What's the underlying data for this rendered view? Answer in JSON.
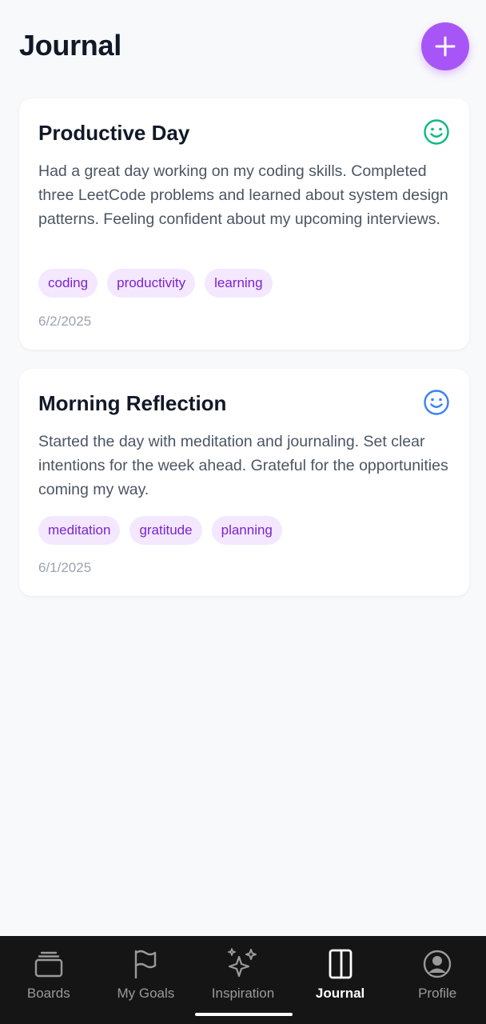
{
  "header": {
    "title": "Journal",
    "add_icon": "plus-icon",
    "accent": "#a855f7"
  },
  "entries": [
    {
      "title": "Productive Day",
      "mood_icon": "smile-icon",
      "mood_color": "#10b981",
      "body": "Had a great day working on my coding skills. Completed three LeetCode problems and learned about system design patterns. Feeling confident about my upcoming interviews.",
      "tags": [
        "coding",
        "productivity",
        "learning"
      ],
      "date": "6/2/2025"
    },
    {
      "title": "Morning Reflection",
      "mood_icon": "smile-icon",
      "mood_color": "#3b82f6",
      "body": "Started the day with meditation and journaling. Set clear intentions for the week ahead. Grateful for the opportunities coming my way.",
      "tags": [
        "meditation",
        "gratitude",
        "planning"
      ],
      "date": "6/1/2025"
    }
  ],
  "nav": {
    "items": [
      {
        "label": "Boards",
        "icon": "boards-icon"
      },
      {
        "label": "My Goals",
        "icon": "flag-icon"
      },
      {
        "label": "Inspiration",
        "icon": "sparkles-icon"
      },
      {
        "label": "Journal",
        "icon": "journal-icon"
      },
      {
        "label": "Profile",
        "icon": "profile-icon"
      }
    ],
    "active": "Journal"
  }
}
